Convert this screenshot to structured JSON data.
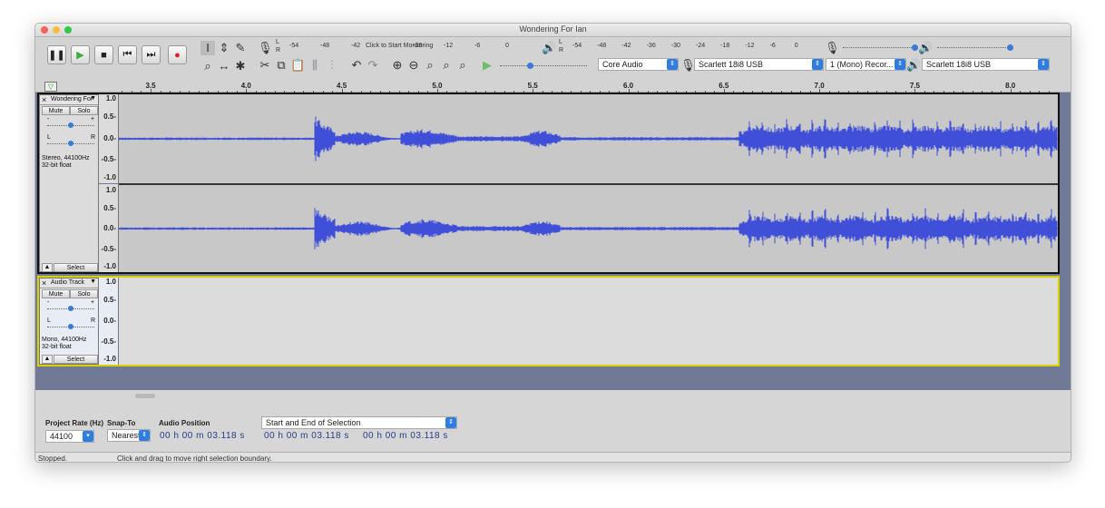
{
  "window": {
    "title": "Wondering For Ian"
  },
  "meters": {
    "record_ticks": [
      "-54",
      "-48",
      "-42",
      "Click to Start Monitoring",
      "-18",
      "-12",
      "-6",
      "0"
    ],
    "play_ticks": [
      "-54",
      "-48",
      "-42",
      "-36",
      "-30",
      "-24",
      "-18",
      "-12",
      "-6",
      "0"
    ],
    "channel_l": "L",
    "channel_r": "R"
  },
  "devices": {
    "host": "Core Audio",
    "recording_device": "Scarlett 18i8 USB",
    "recording_channels": "1 (Mono) Recor...",
    "playback_device": "Scarlett 18i8 USB"
  },
  "ruler": {
    "ticks": [
      "3.5",
      "4.0",
      "4.5",
      "5.0",
      "5.5",
      "6.0",
      "6.5",
      "7.0",
      "7.5",
      "8.0"
    ]
  },
  "tracks": [
    {
      "name": "Wondering For",
      "mute": "Mute",
      "solo": "Solo",
      "info_line1": "Stereo, 44100Hz",
      "info_line2": "32-bit float",
      "select": "Select",
      "scale": [
        "1.0",
        "0.5-",
        "0.0-",
        "-0.5-",
        "-1.0"
      ],
      "scale2": [
        "1.0",
        "0.5-",
        "0.0-",
        "-0.5-",
        "-1.0"
      ]
    },
    {
      "name": "Audio Track",
      "mute": "Mute",
      "solo": "Solo",
      "info_line1": "Mono, 44100Hz",
      "info_line2": "32-bit float",
      "select": "Select",
      "scale": [
        "1.0",
        "0.5-",
        "0.0-",
        "-0.5-",
        "-1.0"
      ]
    }
  ],
  "selection_bar": {
    "project_rate_label": "Project Rate (Hz)",
    "project_rate": "44100",
    "snap_to_label": "Snap-To",
    "snap_to": "Nearest",
    "audio_position_label": "Audio Position",
    "audio_position": "00 h 00 m 03.118 s",
    "selection_mode": "Start and End of Selection",
    "selection_start": "00 h 00 m 03.118 s",
    "selection_end": "00 h 00 m 03.118 s"
  },
  "status": {
    "state": "Stopped.",
    "hint": "Click and drag to move right selection boundary."
  },
  "colors": {
    "waveform": "#3f4fd8",
    "track_bg": "#c8c8c8",
    "accent": "#2f7de1"
  }
}
